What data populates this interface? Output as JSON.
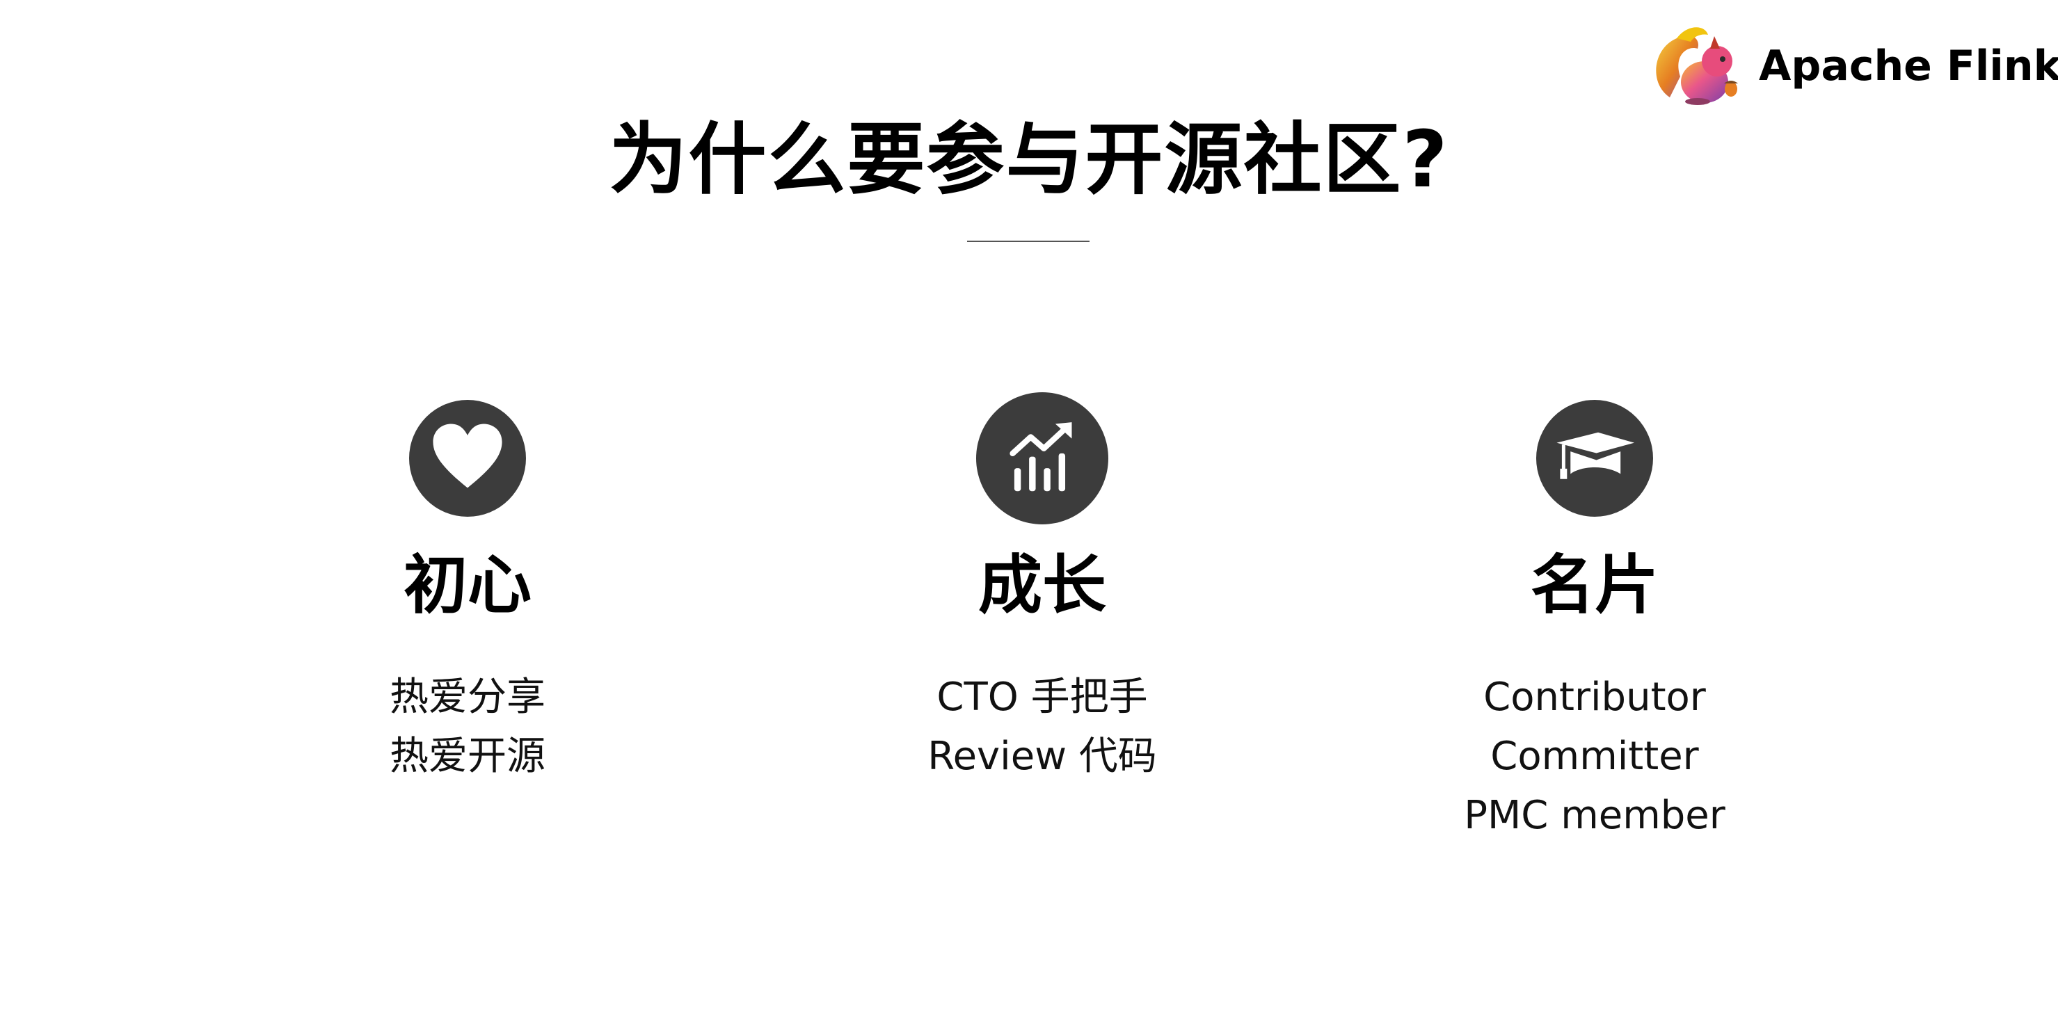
{
  "brand": {
    "name": "Apache Flink",
    "logo_icon": "squirrel-logo-icon"
  },
  "title": "为什么要参与开源社区?",
  "colors": {
    "icon_circle": "#3c3c3c",
    "text": "#000000",
    "rule": "#555555"
  },
  "columns": [
    {
      "icon": "heart-icon",
      "title": "初心",
      "lines": [
        "热爱分享",
        "热爱开源"
      ]
    },
    {
      "icon": "growth-chart-icon",
      "title": "成长",
      "lines": [
        "CTO 手把手",
        "Review 代码"
      ]
    },
    {
      "icon": "graduation-cap-icon",
      "title": "名片",
      "lines": [
        "Contributor",
        "Committer",
        "PMC member"
      ]
    }
  ]
}
